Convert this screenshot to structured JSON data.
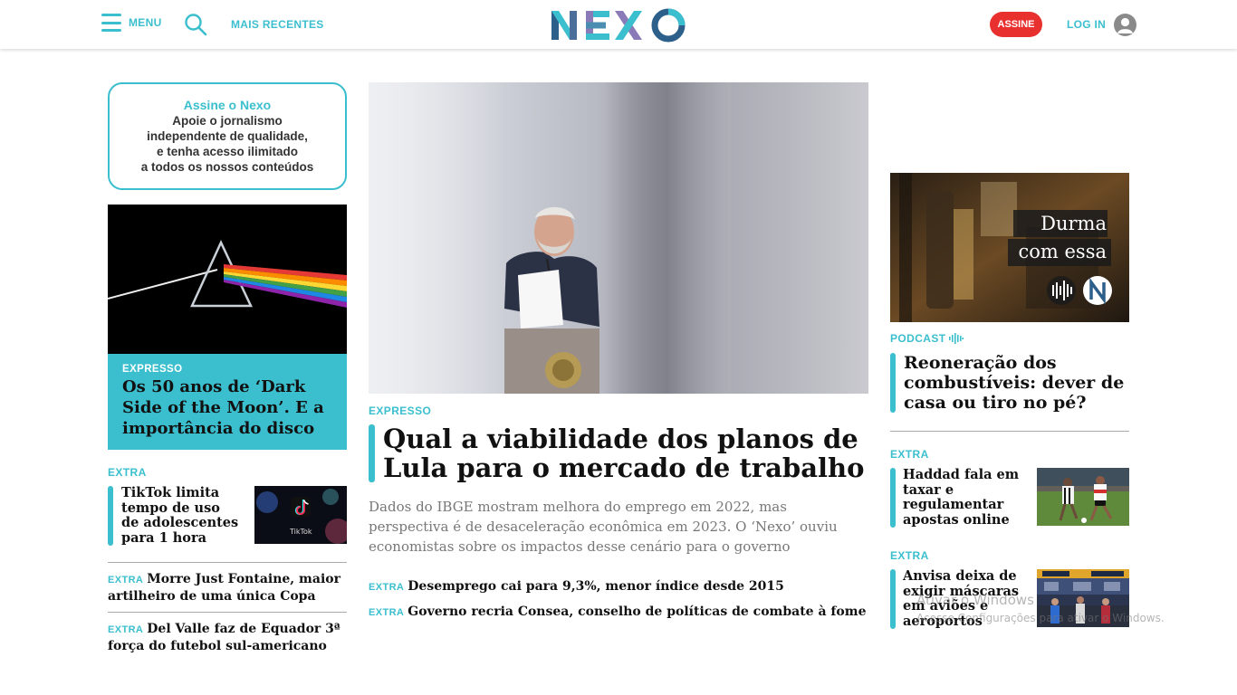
{
  "header": {
    "menu_label": "MENU",
    "recent_label": "MAIS RECENTES",
    "logo_text": "NEXO",
    "subscribe_label": "ASSINE",
    "login_label": "LOG IN"
  },
  "promo": {
    "title": "Assine o Nexo",
    "lines": [
      "Apoie o jornalismo",
      "independente de qualidade,",
      "e tenha acesso ilimitado",
      "a todos os nossos conteúdos"
    ]
  },
  "left": {
    "feature": {
      "kicker": "EXPRESSO",
      "title": "Os 50 anos de ‘Dark Side of the Moon’. E a importância do disco"
    },
    "extra1": {
      "kicker": "EXTRA",
      "title": "TikTok limita tempo de uso de adolescentes para 1 hora",
      "thumb_caption": "TikTok"
    },
    "extra2": {
      "kicker": "EXTRA",
      "title": "Morre Just Fontaine, maior artilheiro de uma única Copa"
    },
    "extra3": {
      "kicker": "EXTRA",
      "title": "Del Valle faz de Equador 3ª força do futebol sul-americano"
    }
  },
  "main": {
    "kicker": "EXPRESSO",
    "title": "Qual a viabilidade dos planos de Lula para o mercado de trabalho",
    "dek": "Dados do IBGE mostram melhora do emprego em 2022, mas perspectiva é de desaceleração econômica em 2023. O ‘Nexo’ ouviu economistas sobre os impactos desse cenário para o governo",
    "links": [
      {
        "kicker": "EXTRA",
        "title": "Desemprego cai para 9,3%, menor índice desde 2015"
      },
      {
        "kicker": "EXTRA",
        "title": "Governo recria Consea, conselho de políticas de combate à fome"
      }
    ]
  },
  "right": {
    "podcast": {
      "image_line1": "Durma",
      "image_line2": "com essa",
      "kicker": "PODCAST",
      "title": "Reoneração dos combustíveis: dever de casa ou tiro no pé?"
    },
    "extra1": {
      "kicker": "EXTRA",
      "title": "Haddad fala em taxar e regulamentar apostas online"
    },
    "extra2": {
      "kicker": "EXTRA",
      "title": "Anvisa deixa de exigir máscaras em aviões e aeroportos"
    }
  },
  "watermark": {
    "line1": "Ativar o Windows",
    "line2": "Acesse Configurações para ativar o Windows."
  },
  "colors": {
    "accent": "#3bbfce",
    "subscribe": "#e8312f"
  }
}
